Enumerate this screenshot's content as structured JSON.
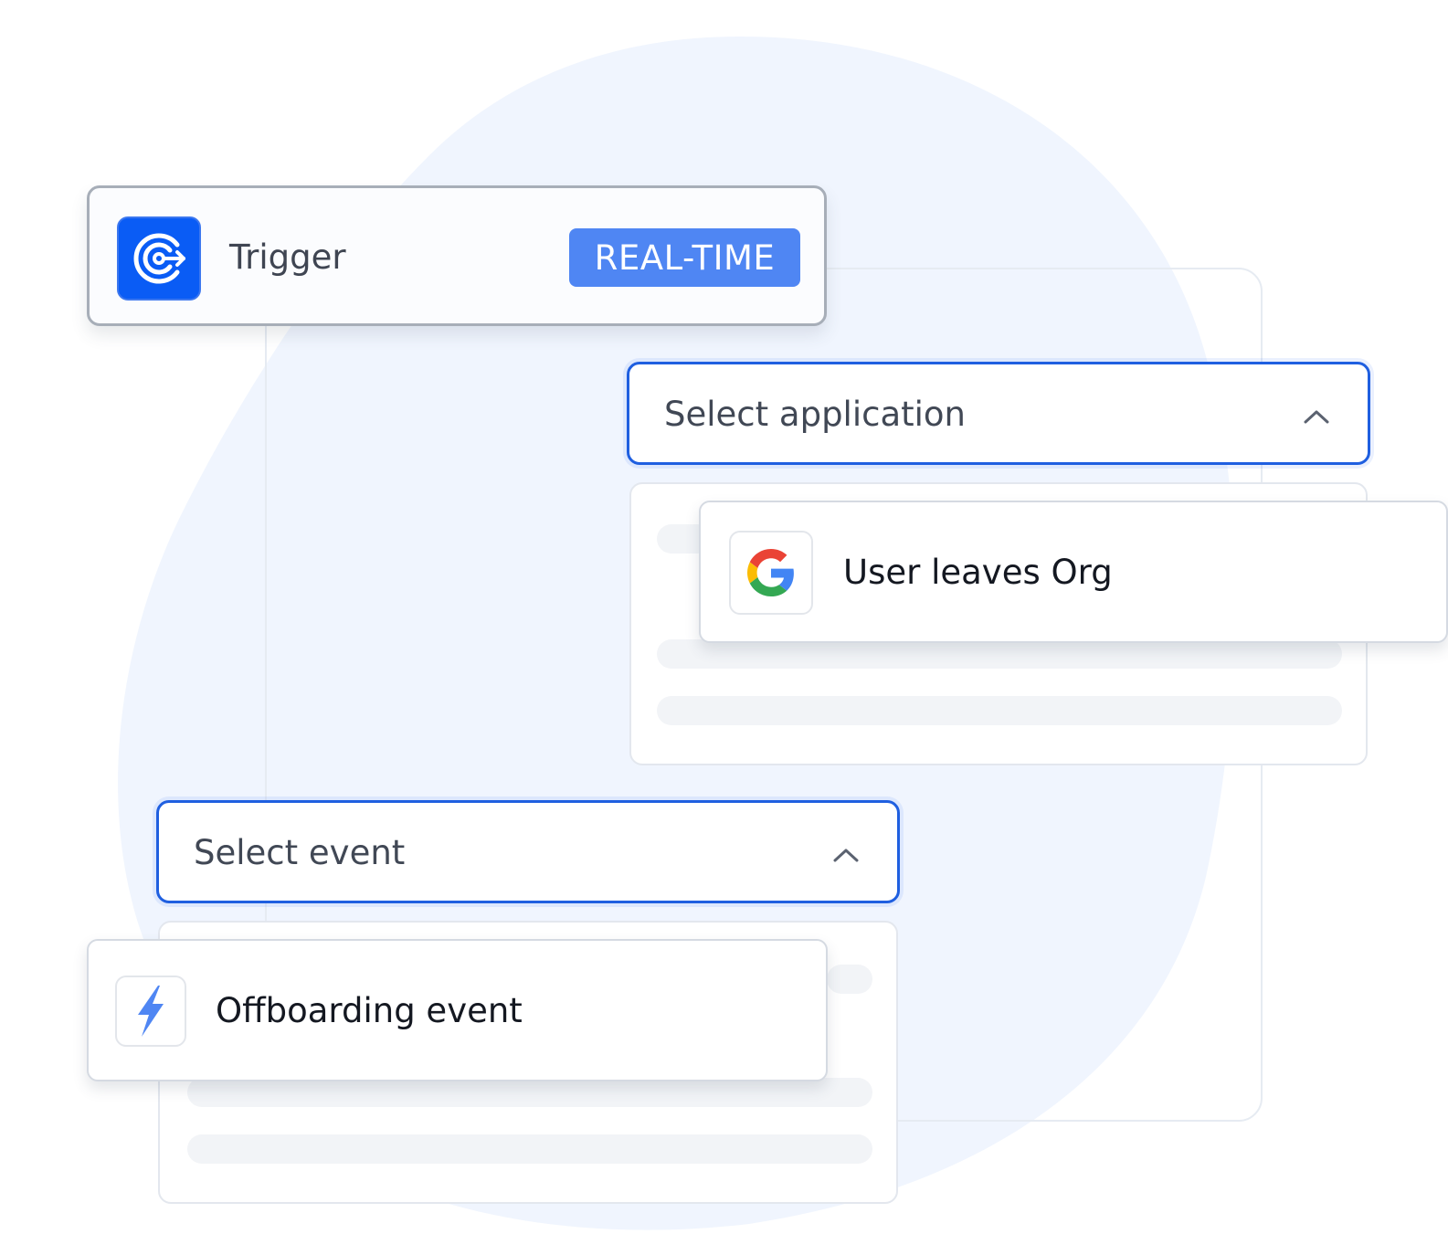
{
  "trigger": {
    "label": "Trigger",
    "badge": "REAL-TIME",
    "icon": "trigger-target-icon"
  },
  "application_select": {
    "placeholder": "Select application",
    "icon": "chevron-up-icon",
    "options": [
      {
        "label": "User leaves Org",
        "icon": "google-icon"
      }
    ]
  },
  "event_select": {
    "placeholder": "Select event",
    "icon": "chevron-up-icon",
    "options": [
      {
        "label": "Offboarding event",
        "icon": "lightning-bolt-icon"
      }
    ]
  },
  "colors": {
    "accent": "#0a5cf5",
    "badge": "#4f86f3",
    "select_border": "#1f5fe0",
    "blob": "#f0f5fe"
  }
}
